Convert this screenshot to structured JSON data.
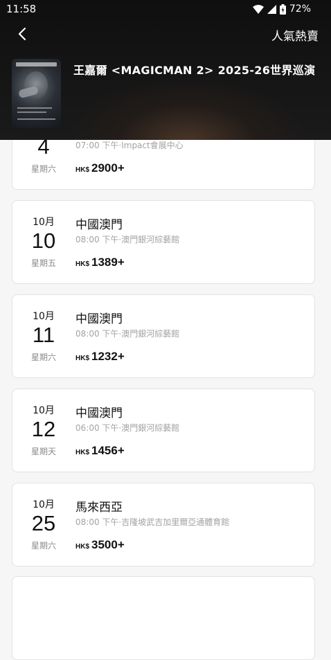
{
  "status_bar": {
    "time": "11:58",
    "battery": "72%"
  },
  "header": {
    "tag": "人氣熱賣",
    "event_title": "王嘉爾 <MAGICMAN 2> 2025-26世界巡演"
  },
  "events": [
    {
      "month": "",
      "day": "4",
      "weekday": "星期六",
      "city": "",
      "meta": "07:00 下午·Impact會展中心",
      "currency": "HK$",
      "price": "2900+"
    },
    {
      "month": "10月",
      "day": "10",
      "weekday": "星期五",
      "city": "中國澳門",
      "meta": "08:00 下午·澳門銀河綜藝館",
      "currency": "HK$",
      "price": "1389+"
    },
    {
      "month": "10月",
      "day": "11",
      "weekday": "星期六",
      "city": "中國澳門",
      "meta": "08:00 下午·澳門銀河綜藝館",
      "currency": "HK$",
      "price": "1232+"
    },
    {
      "month": "10月",
      "day": "12",
      "weekday": "星期天",
      "city": "中國澳門",
      "meta": "06:00 下午·澳門銀河綜藝館",
      "currency": "HK$",
      "price": "1456+"
    },
    {
      "month": "10月",
      "day": "25",
      "weekday": "星期六",
      "city": "馬來西亞",
      "meta": "08:00 下午·吉隆坡武吉加里爾亞通體育館",
      "currency": "HK$",
      "price": "3500+"
    }
  ]
}
